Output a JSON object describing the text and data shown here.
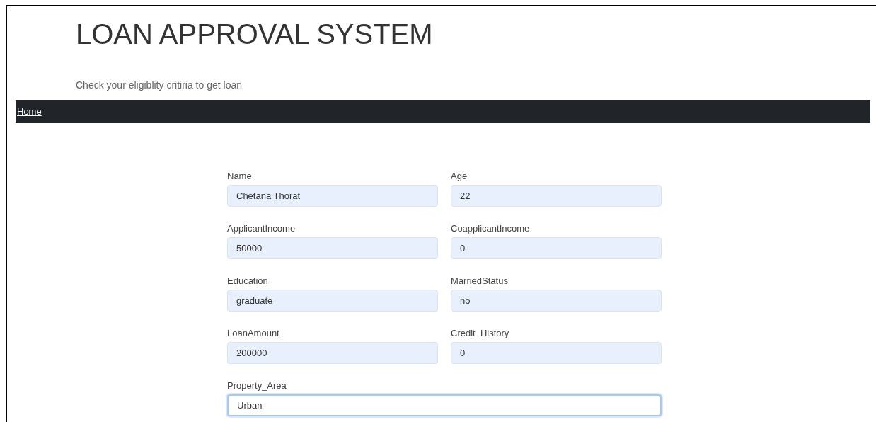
{
  "header": {
    "title": "LOAN APPROVAL SYSTEM",
    "subtitle": "Check your eligiblity critiria to get loan"
  },
  "navbar": {
    "links": [
      {
        "label": "Home"
      }
    ]
  },
  "form": {
    "fields": [
      {
        "kind": "half",
        "label": "Name",
        "value": "Chetana Thorat",
        "focused": false
      },
      {
        "kind": "half",
        "label": "Age",
        "value": "22",
        "focused": false
      },
      {
        "kind": "half",
        "label": "ApplicantIncome",
        "value": "50000",
        "focused": false
      },
      {
        "kind": "half",
        "label": "CoapplicantIncome",
        "value": "0",
        "focused": false
      },
      {
        "kind": "half",
        "label": "Education",
        "value": "graduate",
        "focused": false
      },
      {
        "kind": "half",
        "label": "MarriedStatus",
        "value": "no",
        "focused": false
      },
      {
        "kind": "half",
        "label": "LoanAmount",
        "value": "200000",
        "focused": false
      },
      {
        "kind": "half",
        "label": "Credit_History",
        "value": "0",
        "focused": false
      },
      {
        "kind": "full",
        "label": "Property_Area",
        "value": "Urban",
        "focused": true
      }
    ]
  }
}
